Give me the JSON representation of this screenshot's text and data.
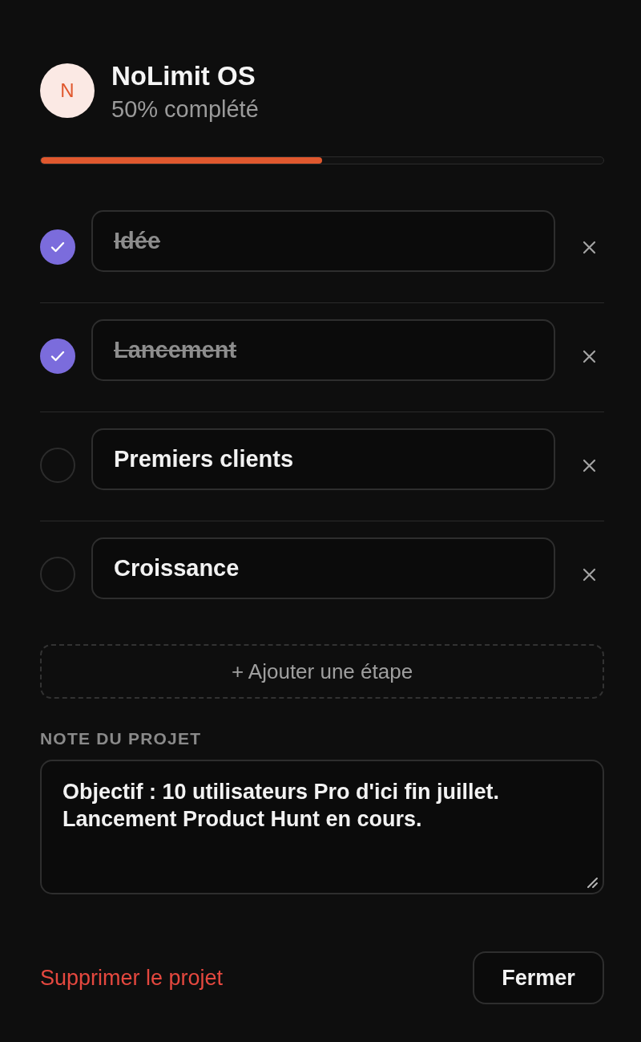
{
  "project": {
    "avatar_letter": "N",
    "title": "NoLimit OS",
    "progress_text": "50% complété",
    "progress": {
      "level": 0.5
    }
  },
  "steps": [
    {
      "name": "Idée",
      "checked": true
    },
    {
      "name": "Lancement",
      "checked": true
    },
    {
      "name": "Premiers clients",
      "checked": false
    },
    {
      "name": "Croissance",
      "checked": false
    }
  ],
  "add_step_button": {
    "label": "+ Ajouter une étape"
  },
  "note": {
    "label": "NOTE DU PROJET",
    "value": "Objectif : 10 utilisateurs Pro d'ici fin juillet.\nLancement Product Hunt en cours."
  },
  "footer": {
    "delete_link": "Supprimer le projet",
    "close_button": "Fermer"
  }
}
